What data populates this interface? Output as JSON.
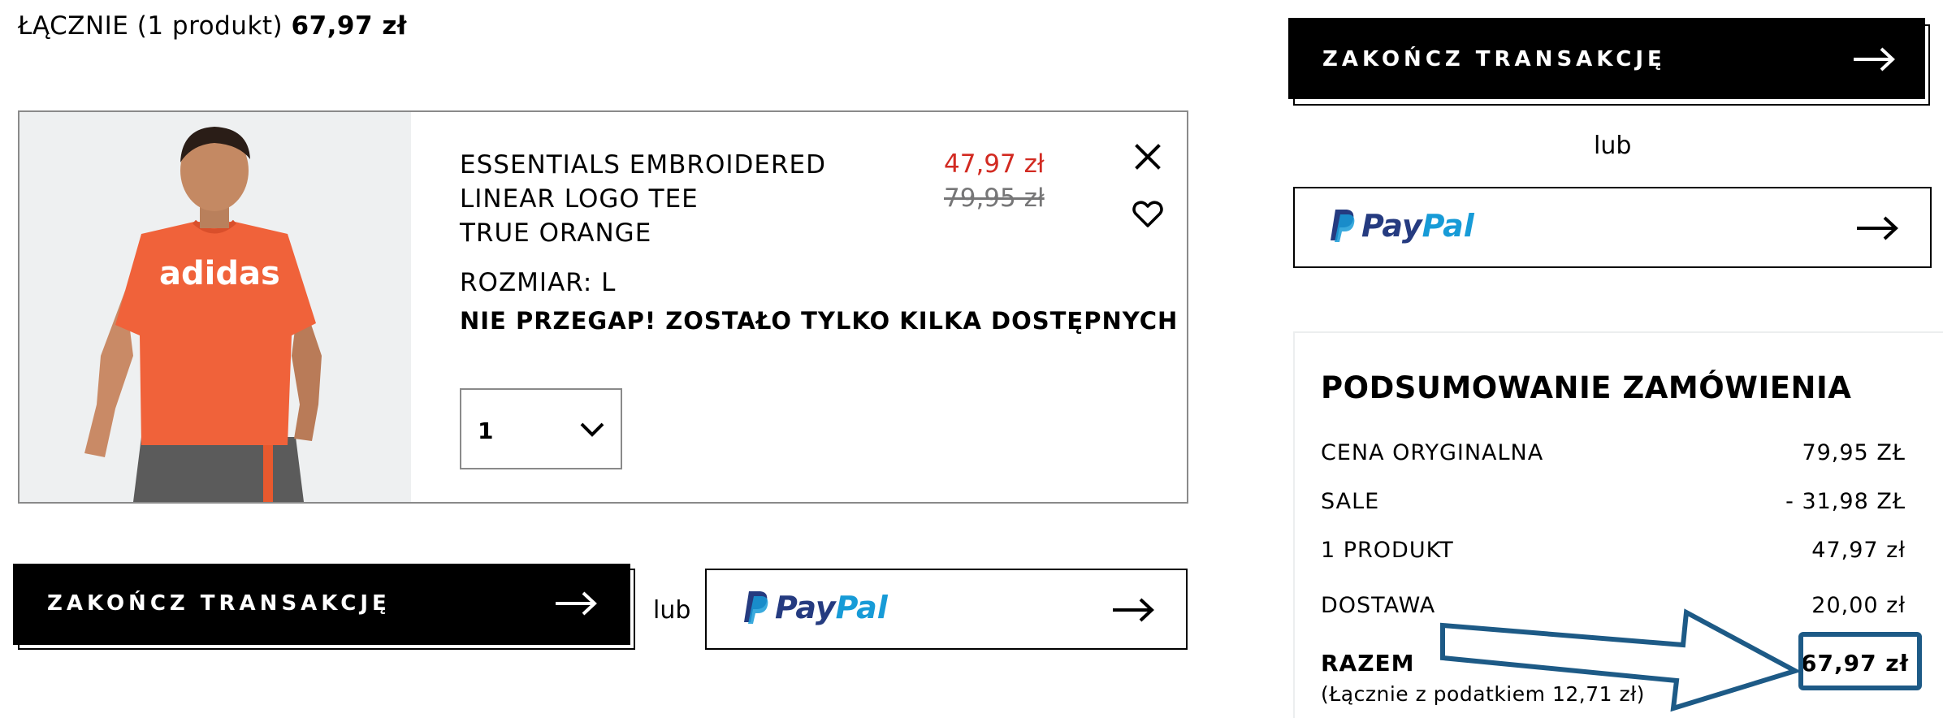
{
  "header": {
    "total_prefix": "ŁĄCZNIE (1 produkt)",
    "total_value": "67,97 zł"
  },
  "product": {
    "name": "ESSENTIALS EMBROIDERED LINEAR LOGO TEE",
    "color": "TRUE ORANGE",
    "size": "ROZMIAR: L",
    "stock_warning": "NIE PRZEGAP! ZOSTAŁO TYLKO KILKA DOSTĘPNYCH",
    "sale_price": "47,97 zł",
    "original_price": "79,95 zł",
    "quantity": "1",
    "image_brand_text": "adidas",
    "colors": {
      "sale": "#d22a21",
      "shirt": "#f0623a",
      "background": "#eef0f1"
    }
  },
  "actions": {
    "checkout_label": "ZAKOŃCZ TRANSAKCJĘ",
    "or_label": "lub",
    "paypal_pay": "Pay",
    "paypal_pal": "Pal"
  },
  "summary": {
    "title": "PODSUMOWANIE ZAMÓWIENIA",
    "rows": [
      {
        "label": "CENA ORYGINALNA",
        "value": "79,95 ZŁ"
      },
      {
        "label": "SALE",
        "value": "- 31,98 ZŁ"
      },
      {
        "label": "1 PRODUKT",
        "value": "47,97 zł"
      },
      {
        "label": "DOSTAWA",
        "value": "20,00 zł"
      }
    ],
    "total_label": "RAZEM",
    "total_value": "67,97 zł",
    "tax_note": "(Łącznie z podatkiem  12,71 zł)"
  },
  "icons": {
    "remove": "close-icon",
    "wishlist": "heart-icon",
    "qty": "chevron-down-icon",
    "arrow": "arrow-right-icon"
  },
  "annotation": {
    "color": "#1d5a86"
  }
}
